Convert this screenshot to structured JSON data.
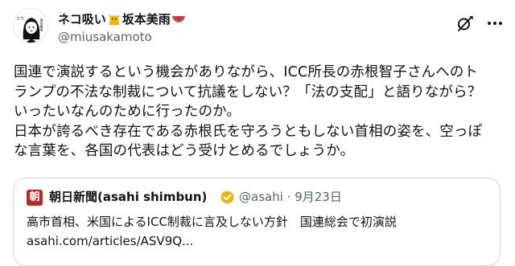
{
  "author": {
    "display_name_part1": "ネコ吸い",
    "display_name_part2": "坂本美雨",
    "handle": "@miusakamoto",
    "avatar_text_left": "ミウ",
    "avatar_text_right": "坂本美雨"
  },
  "tweet": {
    "lines": [
      "国連で演説するという機会がありながら、ICC所長の赤根智子さんへのト",
      "ランプの不法な制裁について抗議をしない？「法の支配」と語りながら？",
      "いったいなんのために行ったのか。",
      "日本が誇るべき存在である赤根氏を守ろうともしない首相の姿を、空っぽ",
      "な言葉を、各国の代表はどう受けとめるでしょうか。"
    ]
  },
  "quote": {
    "logo_char": "朝",
    "name": "朝日新聞(asahi shimbun)",
    "handle": "@asahi",
    "separator": "·",
    "date": "9月23日",
    "text": "高市首相、米国によるICC制裁に言及しない方針　国連総会で初演説",
    "link": "asahi.com/articles/ASV9Q..."
  },
  "colors": {
    "secondary_text": "#536471",
    "border": "#cfd9de",
    "verified_gold": "#e2b719",
    "asahi_red": "#b22a28"
  },
  "icons": [
    "grok-icon",
    "more-icon",
    "cat-emoji-icon",
    "watermelon-emoji-icon",
    "verified-badge-icon"
  ]
}
